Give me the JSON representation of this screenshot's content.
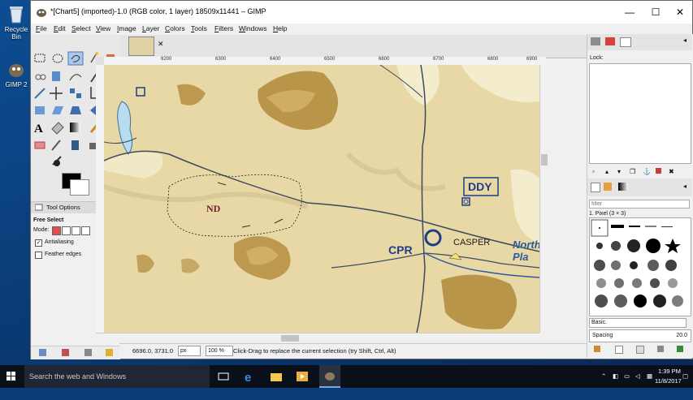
{
  "desktop": {
    "icons": [
      {
        "label": "Recycle Bin"
      },
      {
        "label": "GIMP 2"
      }
    ]
  },
  "window": {
    "title": "*[Chart5] (imported)-1.0 (RGB color, 1 layer) 18509x11441 – GIMP",
    "controls": {
      "minimize": "—",
      "maximize": "☐",
      "close": "✕"
    }
  },
  "menu": [
    "File",
    "Edit",
    "Select",
    "View",
    "Image",
    "Layer",
    "Colors",
    "Tools",
    "Filters",
    "Windows",
    "Help"
  ],
  "tool_options": {
    "tab_label": "Tool Options",
    "tool_name": "Free Select",
    "mode_label": "Mode:",
    "antialiasing": {
      "label": "Antialiasing",
      "checked": true
    },
    "feather": {
      "label": "Feather edges",
      "checked": false
    }
  },
  "ruler": {
    "ticks": [
      "6200",
      "6300",
      "6400",
      "6500",
      "6600",
      "6700",
      "6800",
      "6900"
    ]
  },
  "map": {
    "labels": {
      "ddy": "DDY",
      "cpr": "CPR",
      "casper": "CASPER",
      "north_platte": "North Pla",
      "selection_letters": "ND"
    }
  },
  "status": {
    "coords": "6696.0, 3731.0",
    "unit": "px",
    "zoom": "100 %",
    "hint": "Click-Drag to replace the current selection (try Shift, Ctrl, Alt)"
  },
  "layers_panel": {
    "lock_label": "Lock:"
  },
  "brushes_panel": {
    "filter_placeholder": "filter",
    "brush_name": "1. Pixel (3 × 3)",
    "preset": "Basic.",
    "spacing_label": "Spacing",
    "spacing_value": "20.0"
  },
  "taskbar": {
    "search_placeholder": "Search the web and Windows",
    "time": "1:39 PM",
    "date": "11/8/2017"
  },
  "colors": {
    "map_tan": "#e8d8a6",
    "terrain_dark": "#b08a3a",
    "water": "#b8dcf0",
    "label_blue": "#1d3d86",
    "road": "#3d4a5e"
  }
}
